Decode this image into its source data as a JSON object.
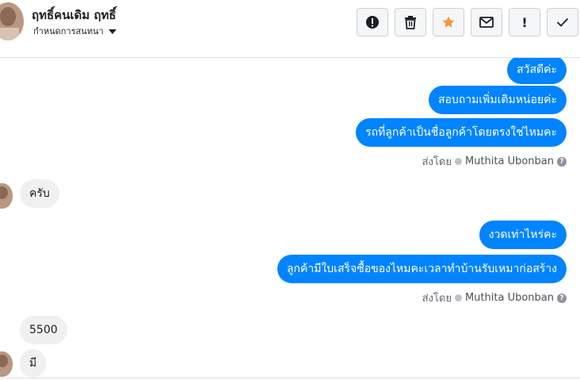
{
  "header": {
    "contact_name": "ฤทธิ์คนเดิม ฤทธิ์",
    "assign_label": "กำหนดการสนทนา",
    "actions": [
      {
        "name": "spam-button",
        "icon": "exclamation-circle-icon"
      },
      {
        "name": "delete-button",
        "icon": "trash-icon"
      },
      {
        "name": "star-button",
        "icon": "star-icon",
        "color": "#f7923b"
      },
      {
        "name": "mark-unread-button",
        "icon": "envelope-icon"
      },
      {
        "name": "follow-up-button",
        "icon": "exclamation-icon",
        "glyph": "!"
      },
      {
        "name": "mark-done-button",
        "icon": "checkmark-icon"
      }
    ]
  },
  "thread": {
    "block1": {
      "messages": [
        "สวัสดีค่ะ",
        "สอบถามเพิ่มเติมหน่อยค่ะ",
        "รถที่ลูกค้าเป็นชื่อลูกค้าโดยตรงใช่ไหมคะ"
      ],
      "sent_by_label": "ส่งโดย",
      "agent": "Muthita Ubonban"
    },
    "reply1": "ครับ",
    "block2": {
      "messages": [
        "งวดเท่าไหร่คะ",
        "ลูกค้ามีใบเสร็จซื้อของไหมคะเวลาทำบ้านรับเหมาก่อสร้าง"
      ],
      "sent_by_label": "ส่งโดย",
      "agent": "Muthita Ubonban"
    },
    "reply2": "5500",
    "reply3": "มี"
  },
  "colors": {
    "outgoing_bubble": "#0084ff",
    "incoming_bubble": "#f1f0f0",
    "star": "#f7923b"
  }
}
